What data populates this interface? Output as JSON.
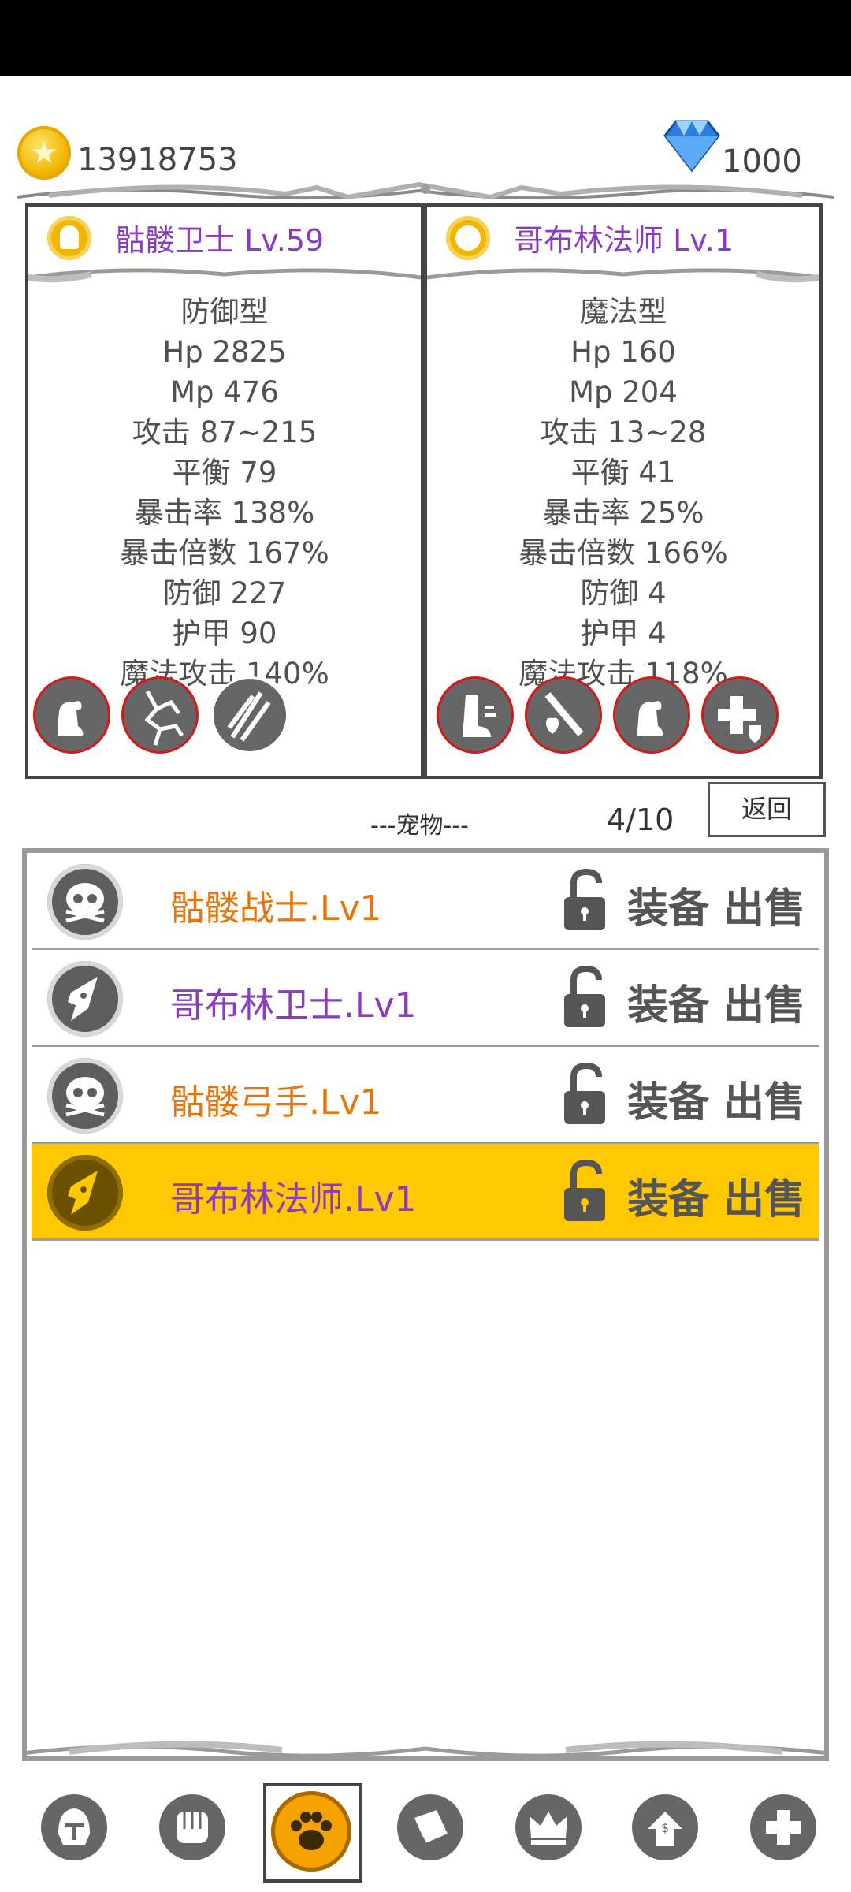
{
  "currency": {
    "gold": "13918753",
    "gems": "1000",
    "gold_icon": "gold-coin-icon",
    "gem_icon": "diamond-icon"
  },
  "panels": {
    "left": {
      "name": "骷髅卫士 Lv.59",
      "type": "防御型",
      "hp": "Hp 2825",
      "mp": "Mp 476",
      "attack": "攻击 87~215",
      "balance": "平衡 79",
      "crit_rate": "暴击率 138%",
      "crit_mult": "暴击倍数 167%",
      "defense": "防御 227",
      "armor": "护甲 90",
      "magic_attack": "魔法攻击 140%"
    },
    "right": {
      "name": "哥布林法师 Lv.1",
      "type": "魔法型",
      "hp": "Hp 160",
      "mp": "Mp 204",
      "attack": "攻击 13~28",
      "balance": "平衡 41",
      "crit_rate": "暴击率 25%",
      "crit_mult": "暴击倍数 166%",
      "defense": "防御 4",
      "armor": "护甲 4",
      "magic_attack": "魔法攻击 118%"
    }
  },
  "pets": {
    "title": "---宠物---",
    "count": "4/10",
    "back_label": "返回",
    "equip_label": "装备",
    "sell_label": "出售",
    "items": [
      {
        "name": "骷髅战士.Lv1",
        "color": "#e8740a",
        "icon": "skull-icon"
      },
      {
        "name": "哥布林卫士.Lv1",
        "color": "#8a3cc0",
        "icon": "goblin-icon"
      },
      {
        "name": "骷髅弓手.Lv1",
        "color": "#e8740a",
        "icon": "skull-icon"
      },
      {
        "name": "哥布林法师.Lv1",
        "color": "#8a3cc0",
        "icon": "goblin-icon"
      }
    ]
  },
  "colors": {
    "selected_row": "#ffc800",
    "purple": "#8a3cc0",
    "orange": "#e8740a"
  },
  "nav": [
    "helmet-icon",
    "fist-icon",
    "paw-icon",
    "book-icon",
    "crown-icon",
    "shop-icon",
    "plus-icon"
  ]
}
